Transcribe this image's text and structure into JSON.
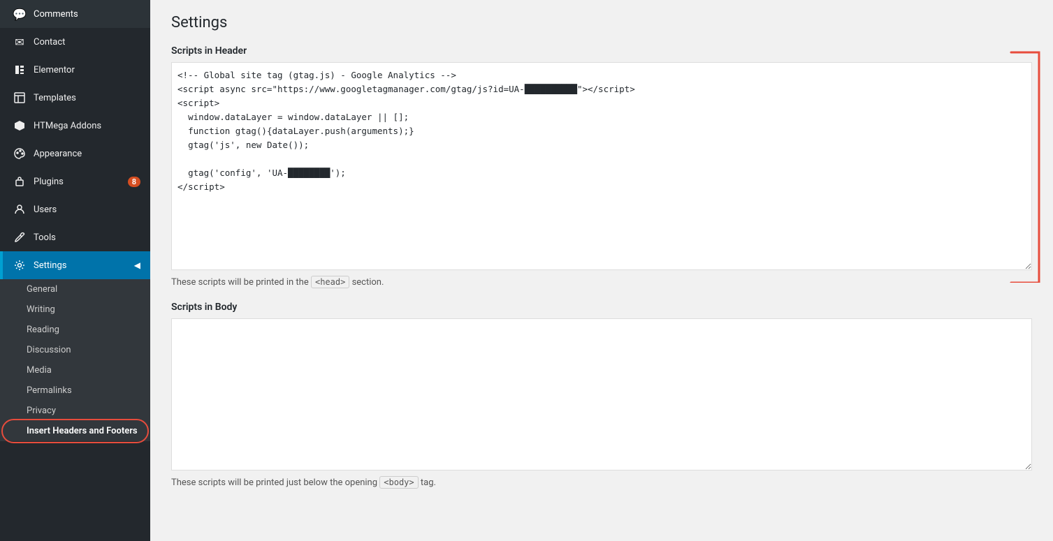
{
  "sidebar": {
    "items": [
      {
        "id": "comments",
        "label": "Comments",
        "icon": "💬"
      },
      {
        "id": "contact",
        "label": "Contact",
        "icon": "✉"
      },
      {
        "id": "elementor",
        "label": "Elementor",
        "icon": "⬜"
      },
      {
        "id": "templates",
        "label": "Templates",
        "icon": "▦"
      },
      {
        "id": "htmega",
        "label": "HTMega Addons",
        "icon": "⬡"
      },
      {
        "id": "appearance",
        "label": "Appearance",
        "icon": "🎨"
      },
      {
        "id": "plugins",
        "label": "Plugins",
        "icon": "🔌",
        "badge": "8"
      },
      {
        "id": "users",
        "label": "Users",
        "icon": "👤"
      },
      {
        "id": "tools",
        "label": "Tools",
        "icon": "🔧"
      },
      {
        "id": "settings",
        "label": "Settings",
        "icon": "⚙",
        "active": true
      }
    ],
    "sub_items": [
      {
        "id": "general",
        "label": "General"
      },
      {
        "id": "writing",
        "label": "Writing"
      },
      {
        "id": "reading",
        "label": "Reading"
      },
      {
        "id": "discussion",
        "label": "Discussion"
      },
      {
        "id": "media",
        "label": "Media"
      },
      {
        "id": "permalinks",
        "label": "Permalinks"
      },
      {
        "id": "privacy",
        "label": "Privacy"
      },
      {
        "id": "insert-headers",
        "label": "Insert Headers and Footers",
        "highlight": true
      }
    ]
  },
  "main": {
    "page_title": "Settings",
    "scripts_header_label": "Scripts in Header",
    "scripts_header_code": "<!-- Global site tag (gtag.js) - Google Analytics -->\n<script async src=\"https://www.googletagmanager.com/gtag/js?id=UA-XXXXXXXX\"></script>\n<script>\n  window.dataLayer = window.dataLayer || [];\n  function gtag(){dataLayer.push(arguments);}\n  gtag('js', new Date());\n\n  gtag('config', 'UA-XXXXXXXX');\n</script>",
    "scripts_header_helper": "These scripts will be printed in the",
    "scripts_header_code_tag": "<head>",
    "scripts_header_suffix": "section.",
    "scripts_body_label": "Scripts in Body",
    "scripts_body_code": "",
    "scripts_body_helper": "These scripts will be printed just below the opening",
    "scripts_body_code_tag": "<body>",
    "scripts_body_suffix": "tag."
  }
}
